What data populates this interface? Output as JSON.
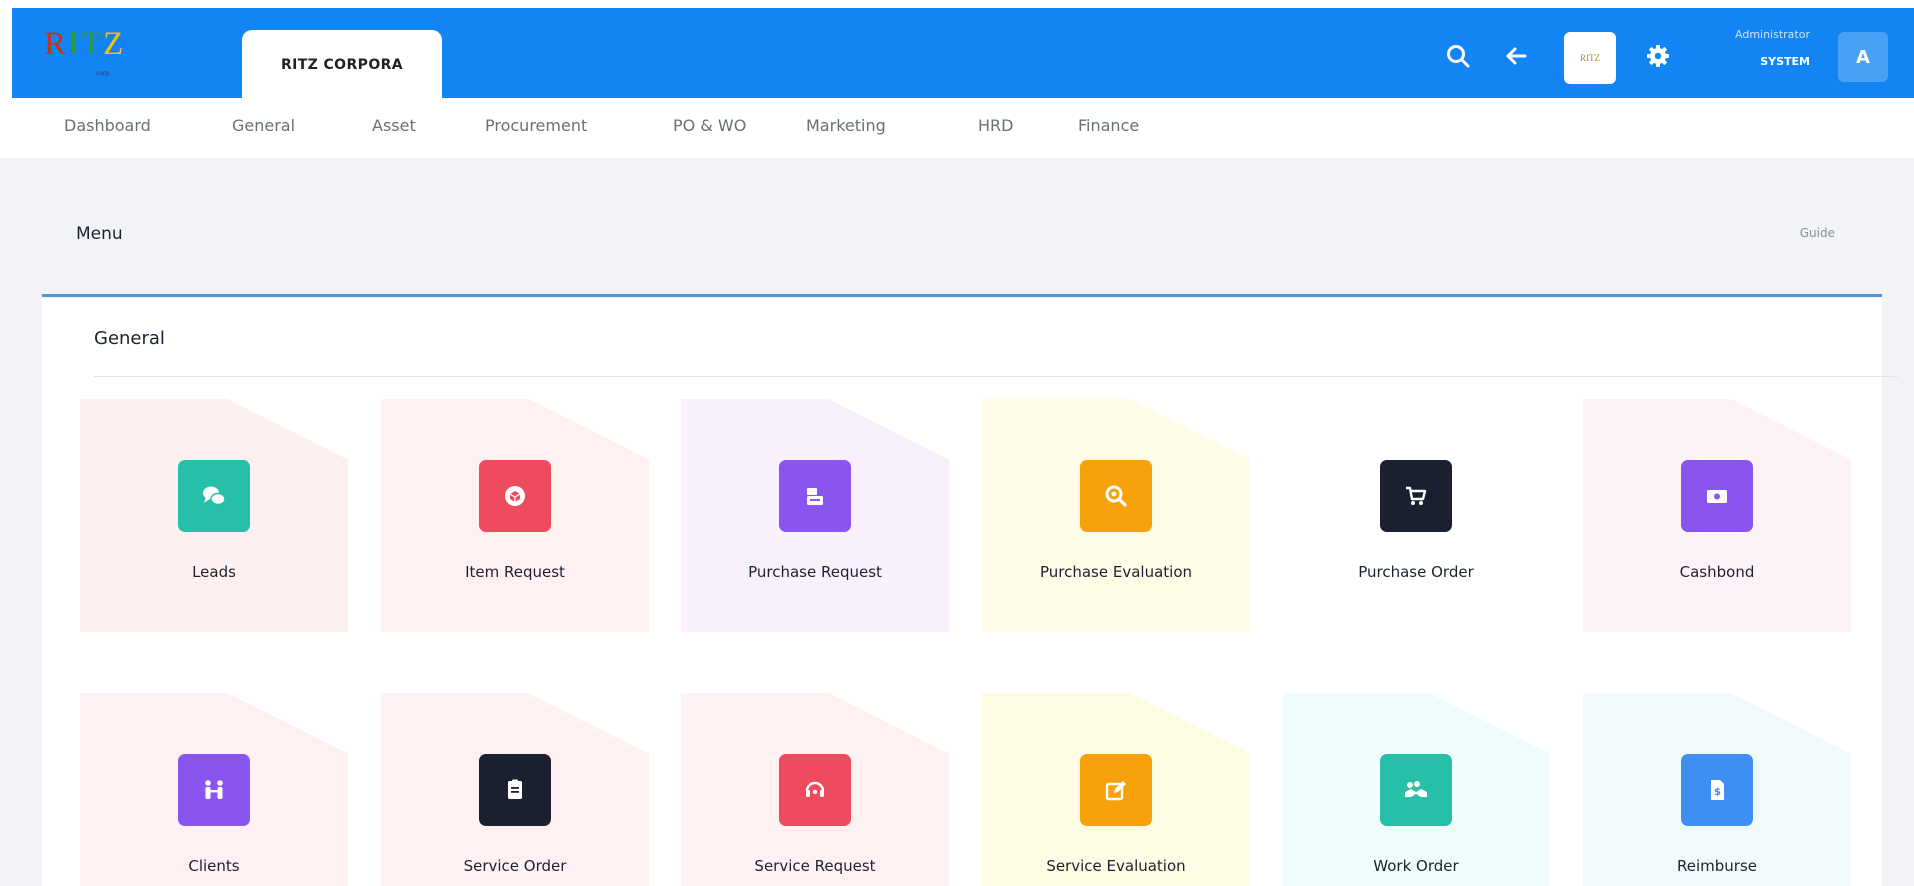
{
  "header": {
    "logo_text": "RITZ",
    "logo_sub": "corp",
    "app_tab": "RITZ CORPORA",
    "thumbnail_text": "RITZ",
    "user": {
      "role": "Administrator",
      "name": "SYSTEM",
      "avatar_initial": "A"
    },
    "icons": [
      "search-icon",
      "back-arrow-icon",
      "gear-icon"
    ],
    "colors": {
      "bar": "#1284f3",
      "avatar": "#47a1f7"
    }
  },
  "nav": {
    "items": [
      {
        "label": "Dashboard"
      },
      {
        "label": "General"
      },
      {
        "label": "Asset"
      },
      {
        "label": "Procurement"
      },
      {
        "label": "PO & WO"
      },
      {
        "label": "Marketing"
      },
      {
        "label": "HRD"
      },
      {
        "label": "Finance"
      }
    ]
  },
  "page": {
    "title": "Menu",
    "guide_label": "Guide",
    "section_title": "General",
    "tiles": [
      {
        "label": "Leads",
        "icon": "chat-bubbles-icon",
        "icon_color": "#27bfa7",
        "tint": "#fff0f0"
      },
      {
        "label": "Item Request",
        "icon": "box-icon",
        "icon_color": "#ef4b5e",
        "tint": "#fff0f1"
      },
      {
        "label": "Purchase Request",
        "icon": "clipboard-icon",
        "icon_color": "#8a55ef",
        "tint": "#f8f1fd"
      },
      {
        "label": "Purchase Evaluation",
        "icon": "magnifier-icon",
        "icon_color": "#f7a20a",
        "tint": "#fefbe6"
      },
      {
        "label": "Purchase Order",
        "icon": "cart-icon",
        "icon_color": "#1b2030",
        "tint": "#ffffff"
      },
      {
        "label": "Cashbond",
        "icon": "money-icon",
        "icon_color": "#8a55ef",
        "tint": "#fcf2f8"
      },
      {
        "label": "Clients",
        "icon": "people-icon",
        "icon_color": "#8a55ef",
        "tint": "#fff0f1"
      },
      {
        "label": "Service Order",
        "icon": "document-icon",
        "icon_color": "#1b2030",
        "tint": "#fff1f2"
      },
      {
        "label": "Service Request",
        "icon": "headset-icon",
        "icon_color": "#ef4b5e",
        "tint": "#fff0f1"
      },
      {
        "label": "Service Evaluation",
        "icon": "edit-icon",
        "icon_color": "#f7a20a",
        "tint": "#fefbe5"
      },
      {
        "label": "Work Order",
        "icon": "handshake-icon",
        "icon_color": "#27bfa7",
        "tint": "#eefcfc"
      },
      {
        "label": "Reimburse",
        "icon": "invoice-icon",
        "icon_color": "#3f8ef2",
        "tint": "#f0fafa"
      }
    ]
  }
}
